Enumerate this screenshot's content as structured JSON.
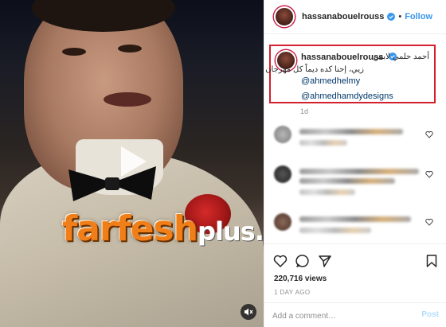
{
  "post": {
    "username": "hassanabouelrouss",
    "follow_label": "Follow",
    "separator": "•",
    "caption": {
      "line1": "أحمد حلمي لابس",
      "line2": "زيي، إحنا كده ديماً كل مهرجان",
      "mention1": "@ahmedhelmy",
      "mention2": "@ahmedhamdydesigns",
      "time": "1d"
    },
    "views": "220,716 views",
    "time_ago": "1 DAY AGO"
  },
  "watermark": {
    "main": "farfesh",
    "plus": "plus",
    "com": ".com"
  },
  "comment_bar": {
    "placeholder": "Add a comment…",
    "post_label": "Post"
  },
  "colors": {
    "follow": "#3897f0",
    "highlight_box": "#d4202c",
    "mention": "#00376b",
    "watermark": "#f07f1a",
    "post_disabled": "#b2dffc"
  },
  "icons": {
    "play": "play-icon",
    "mute": "speaker-muted-icon",
    "verified": "verified-badge-icon",
    "like": "heart-icon",
    "comment": "comment-bubble-icon",
    "share": "paper-plane-icon",
    "save": "bookmark-icon"
  }
}
